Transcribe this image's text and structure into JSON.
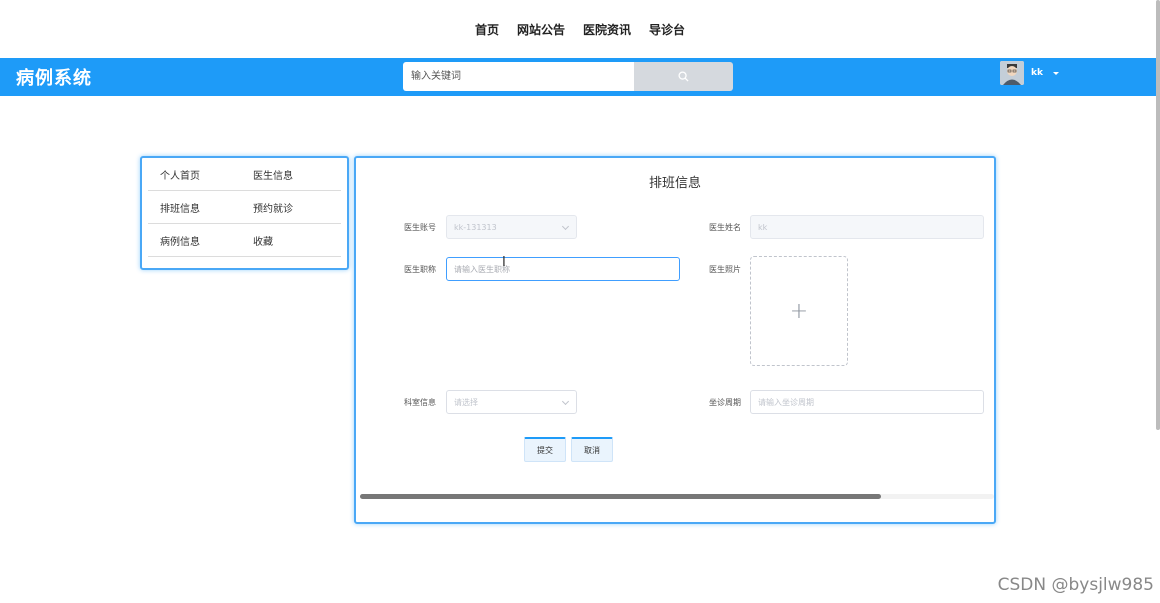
{
  "topnav": {
    "items": [
      "首页",
      "网站公告",
      "医院资讯",
      "导诊台"
    ]
  },
  "header": {
    "brand": "病例系统",
    "search_placeholder": "输入关键词",
    "search_icon": "search-icon",
    "username": "kk",
    "colors": {
      "primary": "#1e9bf8"
    }
  },
  "sidebar": {
    "items": [
      "个人首页",
      "医生信息",
      "排班信息",
      "预约就诊",
      "病例信息",
      "收藏"
    ]
  },
  "form": {
    "title": "排班信息",
    "doctor_account_label": "医生账号",
    "doctor_account_value": "kk-131313",
    "doctor_name_label": "医生姓名",
    "doctor_name_value": "kk",
    "doctor_title_label": "医生职称",
    "doctor_title_placeholder": "请输入医生职称",
    "doctor_photo_label": "医生照片",
    "department_label": "科室信息",
    "department_placeholder": "请选择",
    "schedule_label": "坐诊周期",
    "schedule_placeholder": "请输入坐诊周期",
    "submit_label": "提交",
    "cancel_label": "取消"
  },
  "watermark": "CSDN @bysjlw985"
}
